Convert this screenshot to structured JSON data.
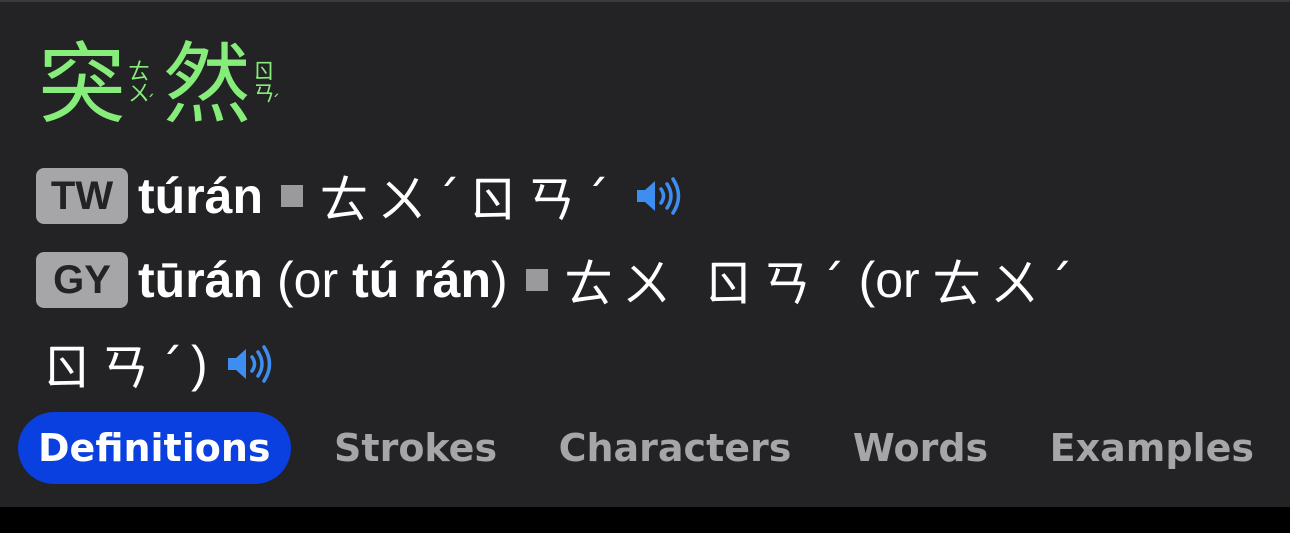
{
  "headword": {
    "chars": [
      {
        "hanzi": "突",
        "bopomofo": "ㄊㄨ",
        "tone": "ˊ"
      },
      {
        "hanzi": "然",
        "bopomofo": "ㄖㄢ",
        "tone": "ˊ"
      }
    ]
  },
  "pronunciations": [
    {
      "badge": "TW",
      "romanization": "túrán",
      "bopomofo": "ㄊㄨˊㄖㄢˊ"
    },
    {
      "badge": "GY",
      "romanization": "tūrán",
      "alt_open": "(or",
      "alt_romanization": "tú rán",
      "alt_close": ")",
      "bopomofo": "ㄊㄨ ㄖㄢˊ",
      "alt_bopomofo_open": "(or",
      "alt_bopomofo_line1": "ㄊㄨˊ",
      "alt_bopomofo_line2": "ㄖㄢˊ",
      "alt_bopomofo_close": ")"
    }
  ],
  "tabs": [
    {
      "label": "Definitions",
      "active": true
    },
    {
      "label": "Strokes",
      "active": false
    },
    {
      "label": "Characters",
      "active": false
    },
    {
      "label": "Words",
      "active": false
    },
    {
      "label": "Examples",
      "active": false
    }
  ],
  "colors": {
    "background": "#232325",
    "headword": "#86ec7a",
    "badge": "#a6a6a8",
    "active_tab": "#0a3fe0",
    "speaker": "#3d8ef0"
  },
  "icons": {
    "audio": "speaker-icon"
  }
}
